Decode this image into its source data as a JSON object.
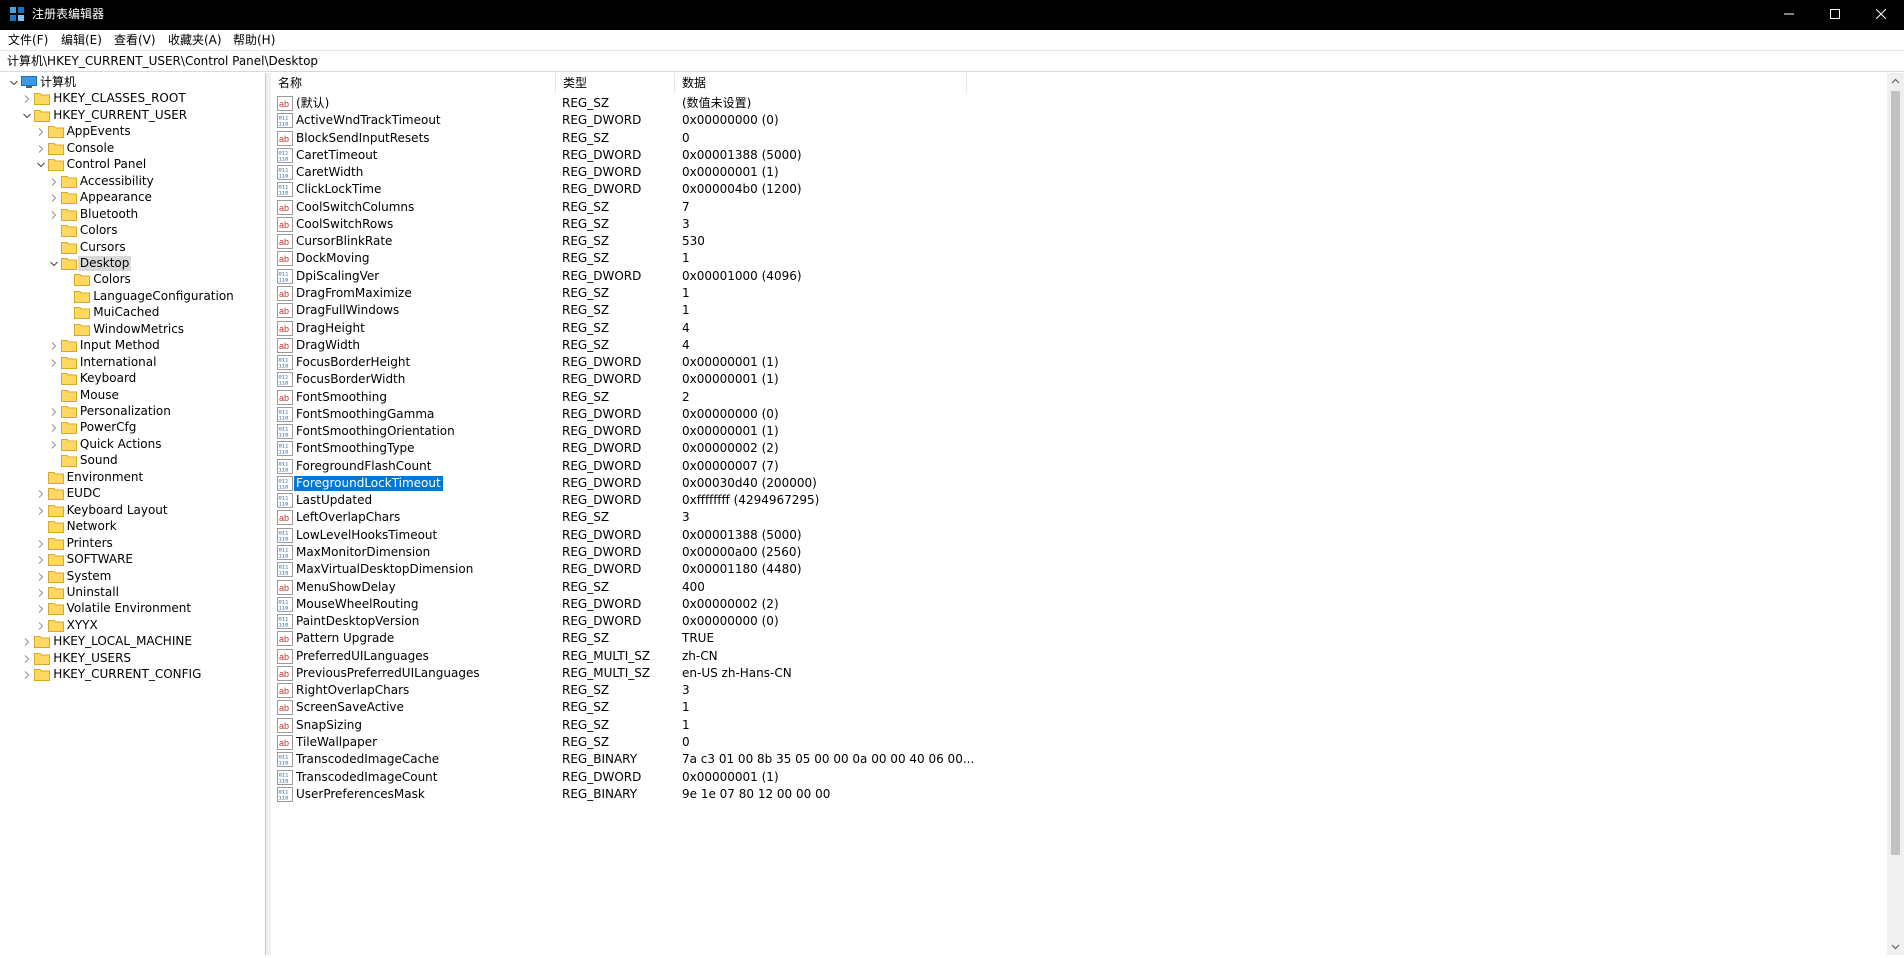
{
  "window": {
    "title": "注册表编辑器",
    "colors": {
      "titlebar_bg": "#000000",
      "selection_bg": "#0078d7",
      "folder": "#ffd861"
    }
  },
  "menu": [
    {
      "label": "文件(F)"
    },
    {
      "label": "编辑(E)"
    },
    {
      "label": "查看(V)"
    },
    {
      "label": "收藏夹(A)"
    },
    {
      "label": "帮助(H)"
    }
  ],
  "address": {
    "path": "计算机\\HKEY_CURRENT_USER\\Control Panel\\Desktop"
  },
  "tree": [
    {
      "label": "计算机",
      "depth": 0,
      "expander": "expanded",
      "icon": "computer-icon"
    },
    {
      "label": "HKEY_CLASSES_ROOT",
      "depth": 1,
      "expander": "collapsed",
      "icon": "folder-icon"
    },
    {
      "label": "HKEY_CURRENT_USER",
      "depth": 1,
      "expander": "expanded",
      "icon": "folder-icon"
    },
    {
      "label": "AppEvents",
      "depth": 2,
      "expander": "collapsed",
      "icon": "folder-icon"
    },
    {
      "label": "Console",
      "depth": 2,
      "expander": "collapsed",
      "icon": "folder-icon"
    },
    {
      "label": "Control Panel",
      "depth": 2,
      "expander": "expanded",
      "icon": "folder-icon"
    },
    {
      "label": "Accessibility",
      "depth": 3,
      "expander": "collapsed",
      "icon": "folder-icon"
    },
    {
      "label": "Appearance",
      "depth": 3,
      "expander": "collapsed",
      "icon": "folder-icon"
    },
    {
      "label": "Bluetooth",
      "depth": 3,
      "expander": "collapsed",
      "icon": "folder-icon"
    },
    {
      "label": "Colors",
      "depth": 3,
      "expander": "none",
      "icon": "folder-icon"
    },
    {
      "label": "Cursors",
      "depth": 3,
      "expander": "none",
      "icon": "folder-icon"
    },
    {
      "label": "Desktop",
      "depth": 3,
      "expander": "expanded",
      "icon": "folder-icon",
      "selected": true
    },
    {
      "label": "Colors",
      "depth": 4,
      "expander": "none",
      "icon": "folder-icon"
    },
    {
      "label": "LanguageConfiguration",
      "depth": 4,
      "expander": "none",
      "icon": "folder-icon"
    },
    {
      "label": "MuiCached",
      "depth": 4,
      "expander": "none",
      "icon": "folder-icon"
    },
    {
      "label": "WindowMetrics",
      "depth": 4,
      "expander": "none",
      "icon": "folder-icon"
    },
    {
      "label": "Input Method",
      "depth": 3,
      "expander": "collapsed",
      "icon": "folder-icon"
    },
    {
      "label": "International",
      "depth": 3,
      "expander": "collapsed",
      "icon": "folder-icon"
    },
    {
      "label": "Keyboard",
      "depth": 3,
      "expander": "none",
      "icon": "folder-icon"
    },
    {
      "label": "Mouse",
      "depth": 3,
      "expander": "none",
      "icon": "folder-icon"
    },
    {
      "label": "Personalization",
      "depth": 3,
      "expander": "collapsed",
      "icon": "folder-icon"
    },
    {
      "label": "PowerCfg",
      "depth": 3,
      "expander": "collapsed",
      "icon": "folder-icon"
    },
    {
      "label": "Quick Actions",
      "depth": 3,
      "expander": "collapsed",
      "icon": "folder-icon"
    },
    {
      "label": "Sound",
      "depth": 3,
      "expander": "none",
      "icon": "folder-icon"
    },
    {
      "label": "Environment",
      "depth": 2,
      "expander": "none",
      "icon": "folder-icon"
    },
    {
      "label": "EUDC",
      "depth": 2,
      "expander": "collapsed",
      "icon": "folder-icon"
    },
    {
      "label": "Keyboard Layout",
      "depth": 2,
      "expander": "collapsed",
      "icon": "folder-icon"
    },
    {
      "label": "Network",
      "depth": 2,
      "expander": "none",
      "icon": "folder-icon"
    },
    {
      "label": "Printers",
      "depth": 2,
      "expander": "collapsed",
      "icon": "folder-icon"
    },
    {
      "label": "SOFTWARE",
      "depth": 2,
      "expander": "collapsed",
      "icon": "folder-icon"
    },
    {
      "label": "System",
      "depth": 2,
      "expander": "collapsed",
      "icon": "folder-icon"
    },
    {
      "label": "Uninstall",
      "depth": 2,
      "expander": "collapsed",
      "icon": "folder-icon"
    },
    {
      "label": "Volatile Environment",
      "depth": 2,
      "expander": "collapsed",
      "icon": "folder-icon"
    },
    {
      "label": "XYYX",
      "depth": 2,
      "expander": "collapsed",
      "icon": "folder-icon"
    },
    {
      "label": "HKEY_LOCAL_MACHINE",
      "depth": 1,
      "expander": "collapsed",
      "icon": "folder-icon"
    },
    {
      "label": "HKEY_USERS",
      "depth": 1,
      "expander": "collapsed",
      "icon": "folder-icon"
    },
    {
      "label": "HKEY_CURRENT_CONFIG",
      "depth": 1,
      "expander": "collapsed",
      "icon": "folder-icon"
    }
  ],
  "list": {
    "headers": {
      "name": "名称",
      "type": "类型",
      "data": "数据"
    },
    "rows": [
      {
        "name": "(默认)",
        "type": "REG_SZ",
        "data": "(数值未设置)",
        "icon": "string-value-icon"
      },
      {
        "name": "ActiveWndTrackTimeout",
        "type": "REG_DWORD",
        "data": "0x00000000 (0)",
        "icon": "binary-value-icon"
      },
      {
        "name": "BlockSendInputResets",
        "type": "REG_SZ",
        "data": "0",
        "icon": "string-value-icon"
      },
      {
        "name": "CaretTimeout",
        "type": "REG_DWORD",
        "data": "0x00001388 (5000)",
        "icon": "binary-value-icon"
      },
      {
        "name": "CaretWidth",
        "type": "REG_DWORD",
        "data": "0x00000001 (1)",
        "icon": "binary-value-icon"
      },
      {
        "name": "ClickLockTime",
        "type": "REG_DWORD",
        "data": "0x000004b0 (1200)",
        "icon": "binary-value-icon"
      },
      {
        "name": "CoolSwitchColumns",
        "type": "REG_SZ",
        "data": "7",
        "icon": "string-value-icon"
      },
      {
        "name": "CoolSwitchRows",
        "type": "REG_SZ",
        "data": "3",
        "icon": "string-value-icon"
      },
      {
        "name": "CursorBlinkRate",
        "type": "REG_SZ",
        "data": "530",
        "icon": "string-value-icon"
      },
      {
        "name": "DockMoving",
        "type": "REG_SZ",
        "data": "1",
        "icon": "string-value-icon"
      },
      {
        "name": "DpiScalingVer",
        "type": "REG_DWORD",
        "data": "0x00001000 (4096)",
        "icon": "binary-value-icon"
      },
      {
        "name": "DragFromMaximize",
        "type": "REG_SZ",
        "data": "1",
        "icon": "string-value-icon"
      },
      {
        "name": "DragFullWindows",
        "type": "REG_SZ",
        "data": "1",
        "icon": "string-value-icon"
      },
      {
        "name": "DragHeight",
        "type": "REG_SZ",
        "data": "4",
        "icon": "string-value-icon"
      },
      {
        "name": "DragWidth",
        "type": "REG_SZ",
        "data": "4",
        "icon": "string-value-icon"
      },
      {
        "name": "FocusBorderHeight",
        "type": "REG_DWORD",
        "data": "0x00000001 (1)",
        "icon": "binary-value-icon"
      },
      {
        "name": "FocusBorderWidth",
        "type": "REG_DWORD",
        "data": "0x00000001 (1)",
        "icon": "binary-value-icon"
      },
      {
        "name": "FontSmoothing",
        "type": "REG_SZ",
        "data": "2",
        "icon": "string-value-icon"
      },
      {
        "name": "FontSmoothingGamma",
        "type": "REG_DWORD",
        "data": "0x00000000 (0)",
        "icon": "binary-value-icon"
      },
      {
        "name": "FontSmoothingOrientation",
        "type": "REG_DWORD",
        "data": "0x00000001 (1)",
        "icon": "binary-value-icon"
      },
      {
        "name": "FontSmoothingType",
        "type": "REG_DWORD",
        "data": "0x00000002 (2)",
        "icon": "binary-value-icon"
      },
      {
        "name": "ForegroundFlashCount",
        "type": "REG_DWORD",
        "data": "0x00000007 (7)",
        "icon": "binary-value-icon"
      },
      {
        "name": "ForegroundLockTimeout",
        "type": "REG_DWORD",
        "data": "0x00030d40 (200000)",
        "icon": "binary-value-icon",
        "selected": true
      },
      {
        "name": "LastUpdated",
        "type": "REG_DWORD",
        "data": "0xffffffff (4294967295)",
        "icon": "binary-value-icon"
      },
      {
        "name": "LeftOverlapChars",
        "type": "REG_SZ",
        "data": "3",
        "icon": "string-value-icon"
      },
      {
        "name": "LowLevelHooksTimeout",
        "type": "REG_DWORD",
        "data": "0x00001388 (5000)",
        "icon": "binary-value-icon"
      },
      {
        "name": "MaxMonitorDimension",
        "type": "REG_DWORD",
        "data": "0x00000a00 (2560)",
        "icon": "binary-value-icon"
      },
      {
        "name": "MaxVirtualDesktopDimension",
        "type": "REG_DWORD",
        "data": "0x00001180 (4480)",
        "icon": "binary-value-icon"
      },
      {
        "name": "MenuShowDelay",
        "type": "REG_SZ",
        "data": "400",
        "icon": "string-value-icon"
      },
      {
        "name": "MouseWheelRouting",
        "type": "REG_DWORD",
        "data": "0x00000002 (2)",
        "icon": "binary-value-icon"
      },
      {
        "name": "PaintDesktopVersion",
        "type": "REG_DWORD",
        "data": "0x00000000 (0)",
        "icon": "binary-value-icon"
      },
      {
        "name": "Pattern Upgrade",
        "type": "REG_SZ",
        "data": "TRUE",
        "icon": "string-value-icon"
      },
      {
        "name": "PreferredUILanguages",
        "type": "REG_MULTI_SZ",
        "data": "zh-CN",
        "icon": "string-value-icon"
      },
      {
        "name": "PreviousPreferredUILanguages",
        "type": "REG_MULTI_SZ",
        "data": "en-US zh-Hans-CN",
        "icon": "string-value-icon"
      },
      {
        "name": "RightOverlapChars",
        "type": "REG_SZ",
        "data": "3",
        "icon": "string-value-icon"
      },
      {
        "name": "ScreenSaveActive",
        "type": "REG_SZ",
        "data": "1",
        "icon": "string-value-icon"
      },
      {
        "name": "SnapSizing",
        "type": "REG_SZ",
        "data": "1",
        "icon": "string-value-icon"
      },
      {
        "name": "TileWallpaper",
        "type": "REG_SZ",
        "data": "0",
        "icon": "string-value-icon"
      },
      {
        "name": "TranscodedImageCache",
        "type": "REG_BINARY",
        "data": "7a c3 01 00 8b 35 05 00 00 0a 00 00 40 06 00...",
        "icon": "binary-value-icon"
      },
      {
        "name": "TranscodedImageCount",
        "type": "REG_DWORD",
        "data": "0x00000001 (1)",
        "icon": "binary-value-icon"
      },
      {
        "name": "UserPreferencesMask",
        "type": "REG_BINARY",
        "data": "9e 1e 07 80 12 00 00 00",
        "icon": "binary-value-icon"
      }
    ]
  }
}
